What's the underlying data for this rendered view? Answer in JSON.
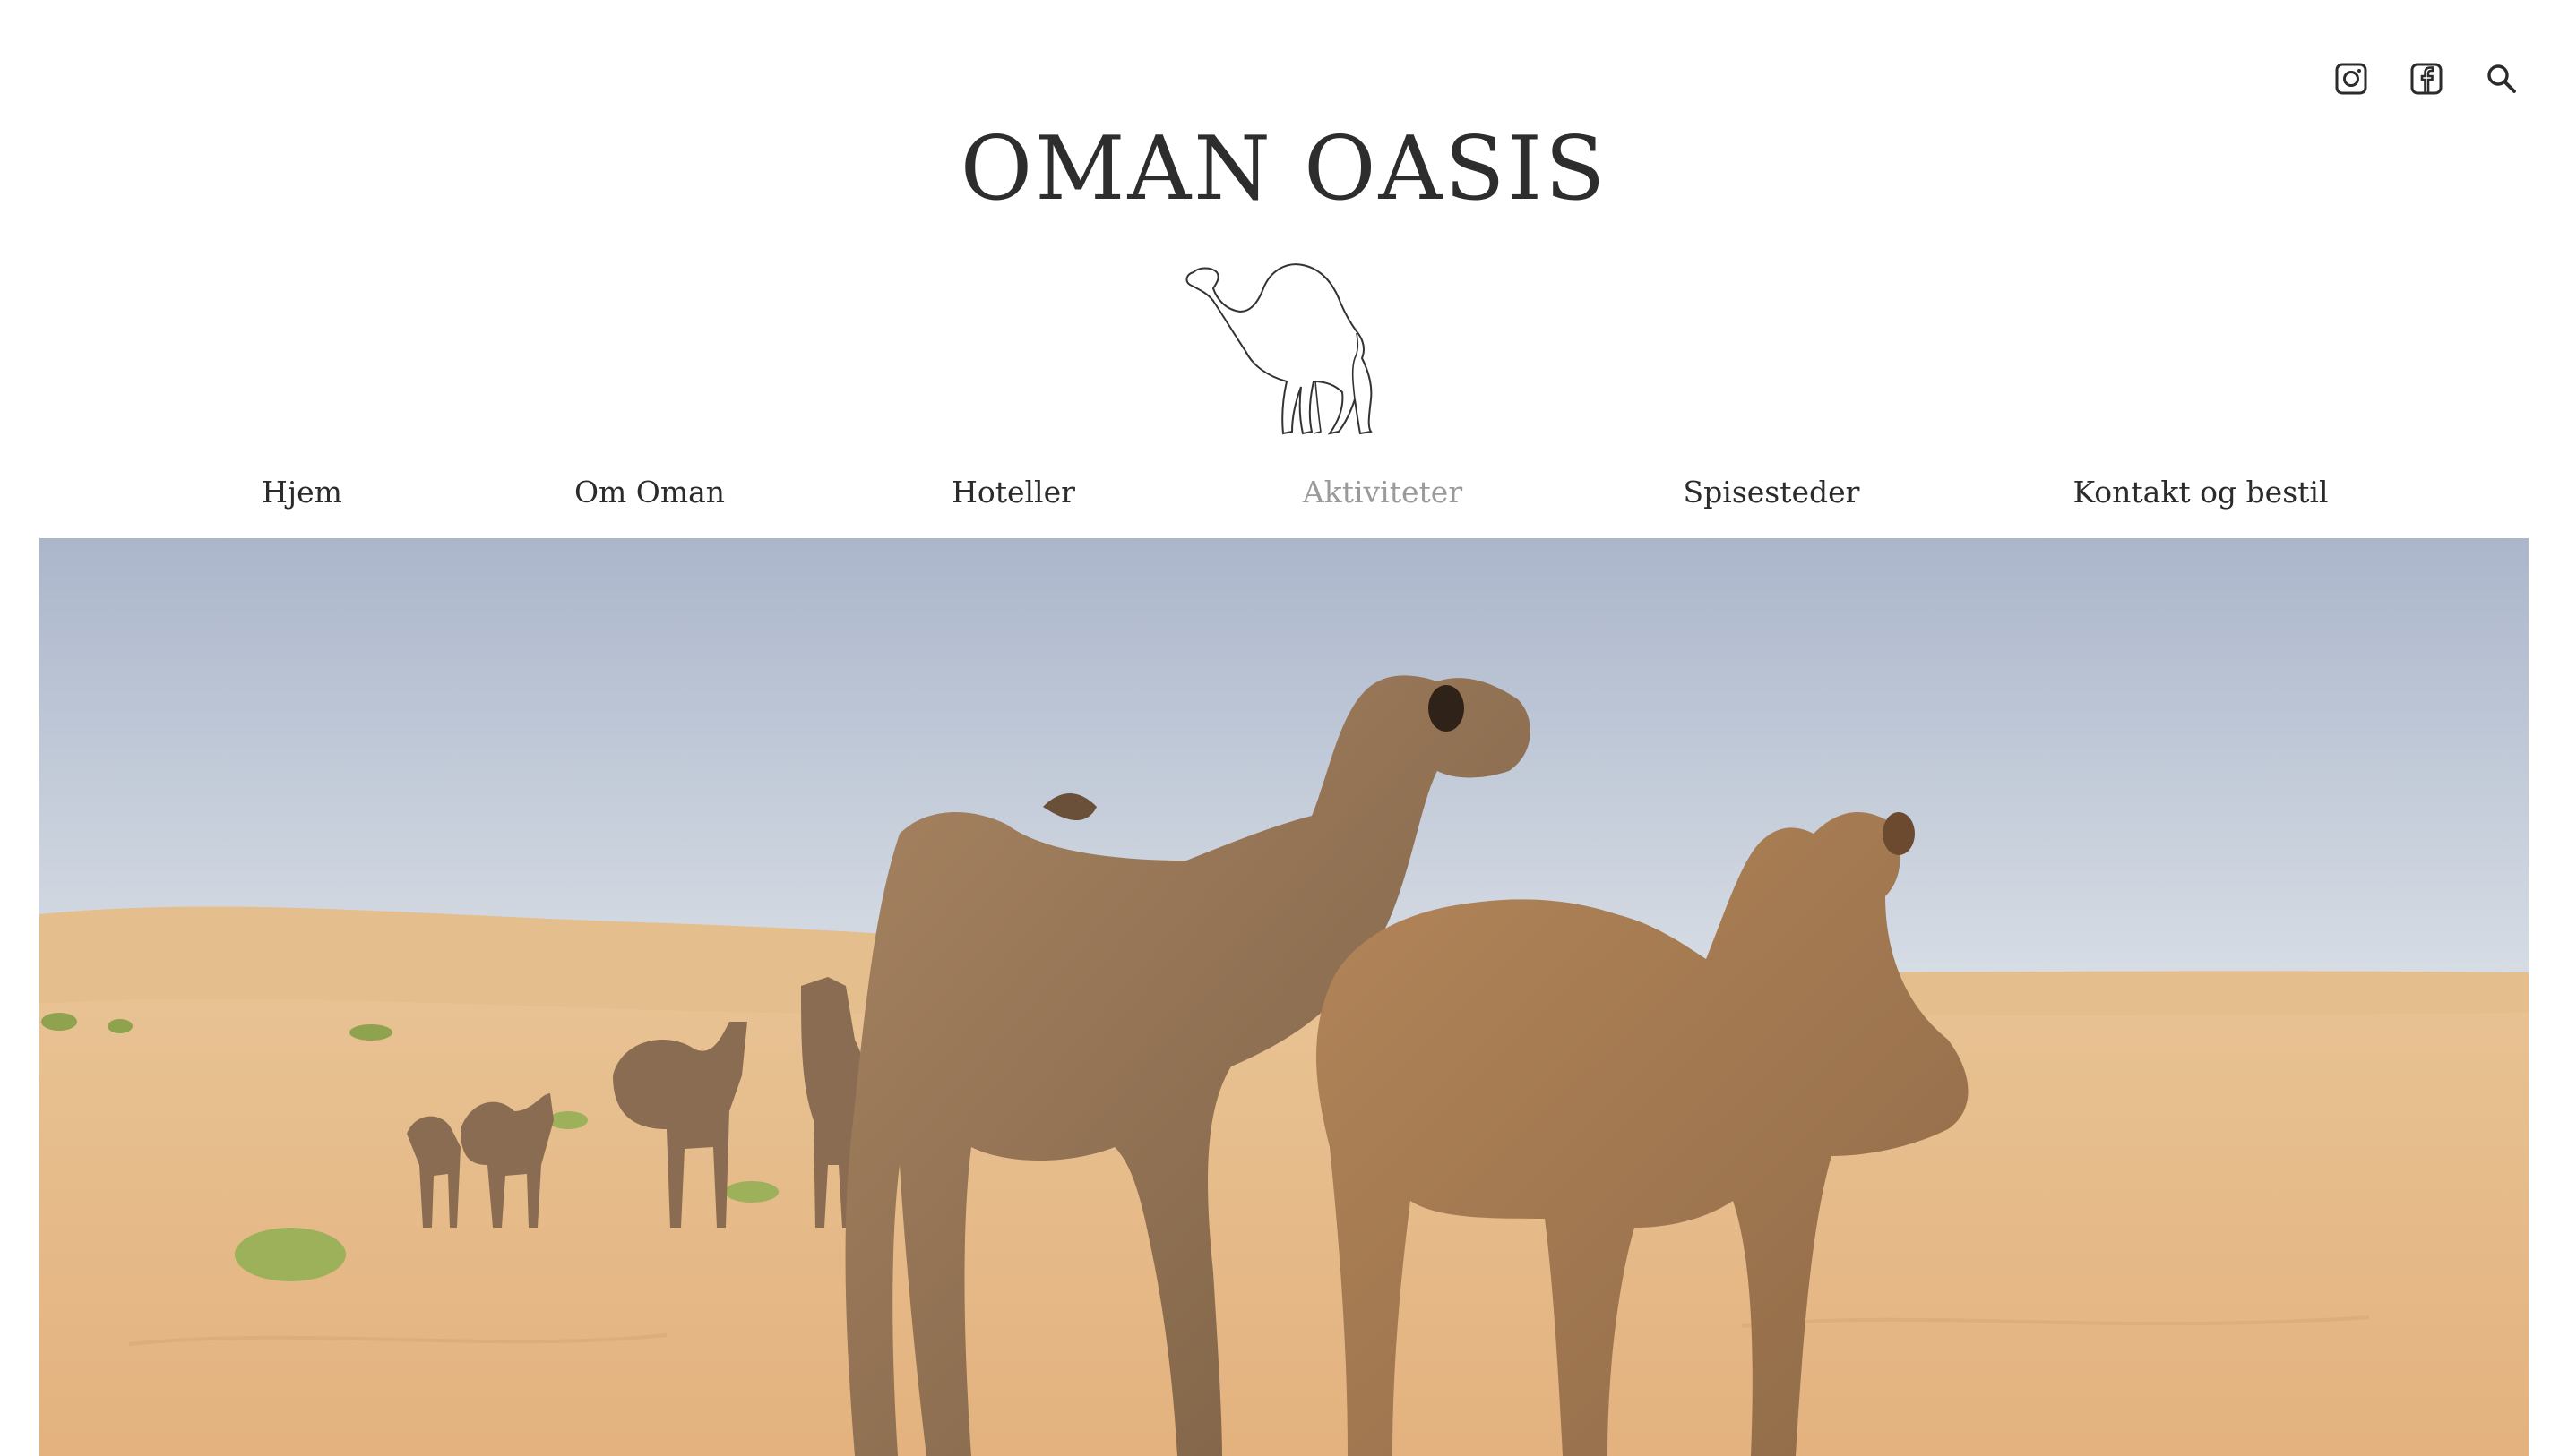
{
  "header": {
    "title": "OMAN OASIS",
    "logo_icon": "camel-icon",
    "social_icons": [
      "instagram-icon",
      "facebook-icon",
      "search-icon"
    ]
  },
  "nav": {
    "items": [
      {
        "label": "Hjem",
        "active": false
      },
      {
        "label": "Om Oman",
        "active": false
      },
      {
        "label": "Hoteller",
        "active": false
      },
      {
        "label": "Aktiviteter",
        "active": true
      },
      {
        "label": "Spisesteder",
        "active": false
      },
      {
        "label": "Kontakt og bestil",
        "active": false
      }
    ]
  },
  "colors": {
    "text": "#2b2b2b",
    "active_nav": "#9a9a9a",
    "sky": "#b3bed0",
    "sand": "#e4bb88"
  }
}
